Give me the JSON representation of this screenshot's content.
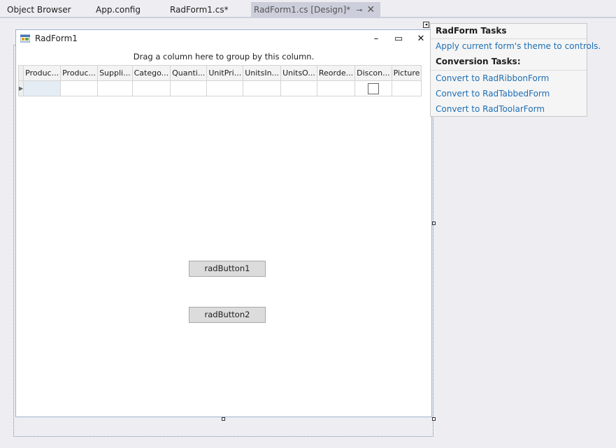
{
  "tabs": [
    {
      "label": "Object Browser"
    },
    {
      "label": "App.config"
    },
    {
      "label": "RadForm1.cs*"
    },
    {
      "label": "RadForm1.cs [Design]*",
      "pin": "⊸",
      "close": "✕"
    }
  ],
  "form": {
    "title": "RadForm1",
    "minimize": "–",
    "maximize": "▭",
    "close": "✕"
  },
  "grid": {
    "group_panel_text": "Drag a column here to group by this column.",
    "columns": [
      "Produc...",
      "Produc...",
      "Suppli...",
      "Catego...",
      "Quanti...",
      "UnitPri...",
      "UnitsIn...",
      "UnitsO...",
      "Reorde...",
      "Discon...",
      "Picture"
    ],
    "row_indicator": "▶"
  },
  "buttons": {
    "button1": "radButton1",
    "button2": "radButton2"
  },
  "tasks": {
    "title": "RadForm Tasks",
    "apply_theme": "Apply current form's theme to controls.",
    "conversion_heading": "Conversion Tasks:",
    "convert_ribbon": "Convert to RadRibbonForm",
    "convert_tabbed": "Convert to RadTabbedForm",
    "convert_toolbar": "Convert to RadToolarForm"
  },
  "colors": {
    "background": "#eeeef2",
    "active_tab": "#cccedb",
    "link": "#1e6fb4",
    "selection_border": "#6a8fb8"
  }
}
